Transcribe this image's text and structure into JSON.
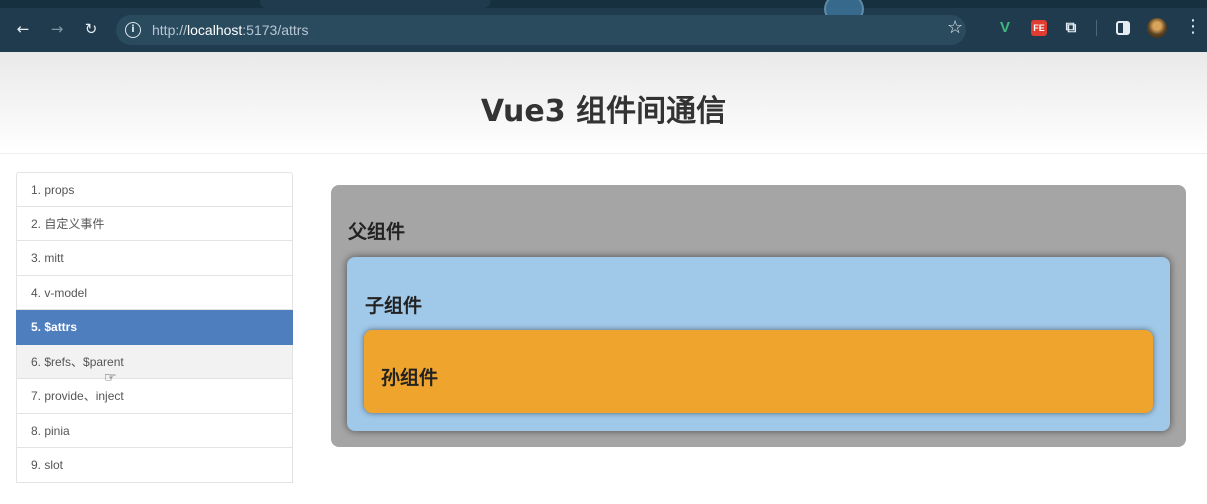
{
  "browser": {
    "back_icon": "arrow-left-icon",
    "forward_icon": "arrow-right-icon",
    "reload_icon": "reload-icon",
    "url_scheme": "http://",
    "url_host": "localhost",
    "url_rest": ":5173/attrs",
    "extensions": [
      "vue-devtools-icon",
      "fe-helper-icon",
      "puzzle-icon",
      "side-panel-icon"
    ],
    "vue_ext_label": "V",
    "fe_ext_label": "FE"
  },
  "header": {
    "title": "Vue3 组件间通信"
  },
  "sidebar": {
    "items": [
      {
        "label": "1. props"
      },
      {
        "label": "2. 自定义事件"
      },
      {
        "label": "3. mitt"
      },
      {
        "label": "4. v-model"
      },
      {
        "label": "5. $attrs",
        "active": true
      },
      {
        "label": "6. $refs、$parent",
        "hover": true
      },
      {
        "label": "7. provide、inject"
      },
      {
        "label": "8. pinia"
      },
      {
        "label": "9. slot"
      }
    ]
  },
  "main": {
    "parent_title": "父组件",
    "child_title": "子组件",
    "grandchild_title": "孙组件"
  },
  "colors": {
    "active_item": "#4f7ebf",
    "parent_bg": "#a5a5a5",
    "child_bg": "#a0c8e8",
    "grandchild_bg": "#efa52d"
  }
}
